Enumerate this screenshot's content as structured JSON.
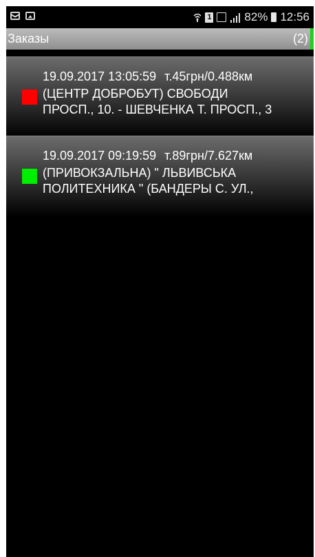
{
  "status_bar": {
    "battery": "82%",
    "time": "12:56",
    "sim_label": "1",
    "icons": [
      "mail-icon",
      "gallery-icon",
      "wifi-icon",
      "sim-icon",
      "network-icon",
      "signal-icon",
      "battery-icon"
    ]
  },
  "title_bar": {
    "title": "Заказы",
    "count": "(2)",
    "accent_color": "#1dd11d"
  },
  "orders": [
    {
      "datetime": "19.09.2017 13:05:59",
      "price_distance": "т.45грн/0.488км",
      "address_line1": "(ЦЕНТР ДОБРОБУТ) СВОБОДИ",
      "address_line2": "ПРОСП., 10.  - ШЕВЧЕНКА Т. ПРОСП., 3",
      "status_color": "#ff0000"
    },
    {
      "datetime": "19.09.2017 09:19:59",
      "price_distance": "т.89грн/7.627км",
      "address_line1": "(ПРИВОКЗАЛЬНА) \" ЛЬВИВСЬКА",
      "address_line2": "ПОЛИТЕХНИКА \" (БАНДЕРЫ С. УЛ.,",
      "status_color": "#00ee00"
    }
  ]
}
